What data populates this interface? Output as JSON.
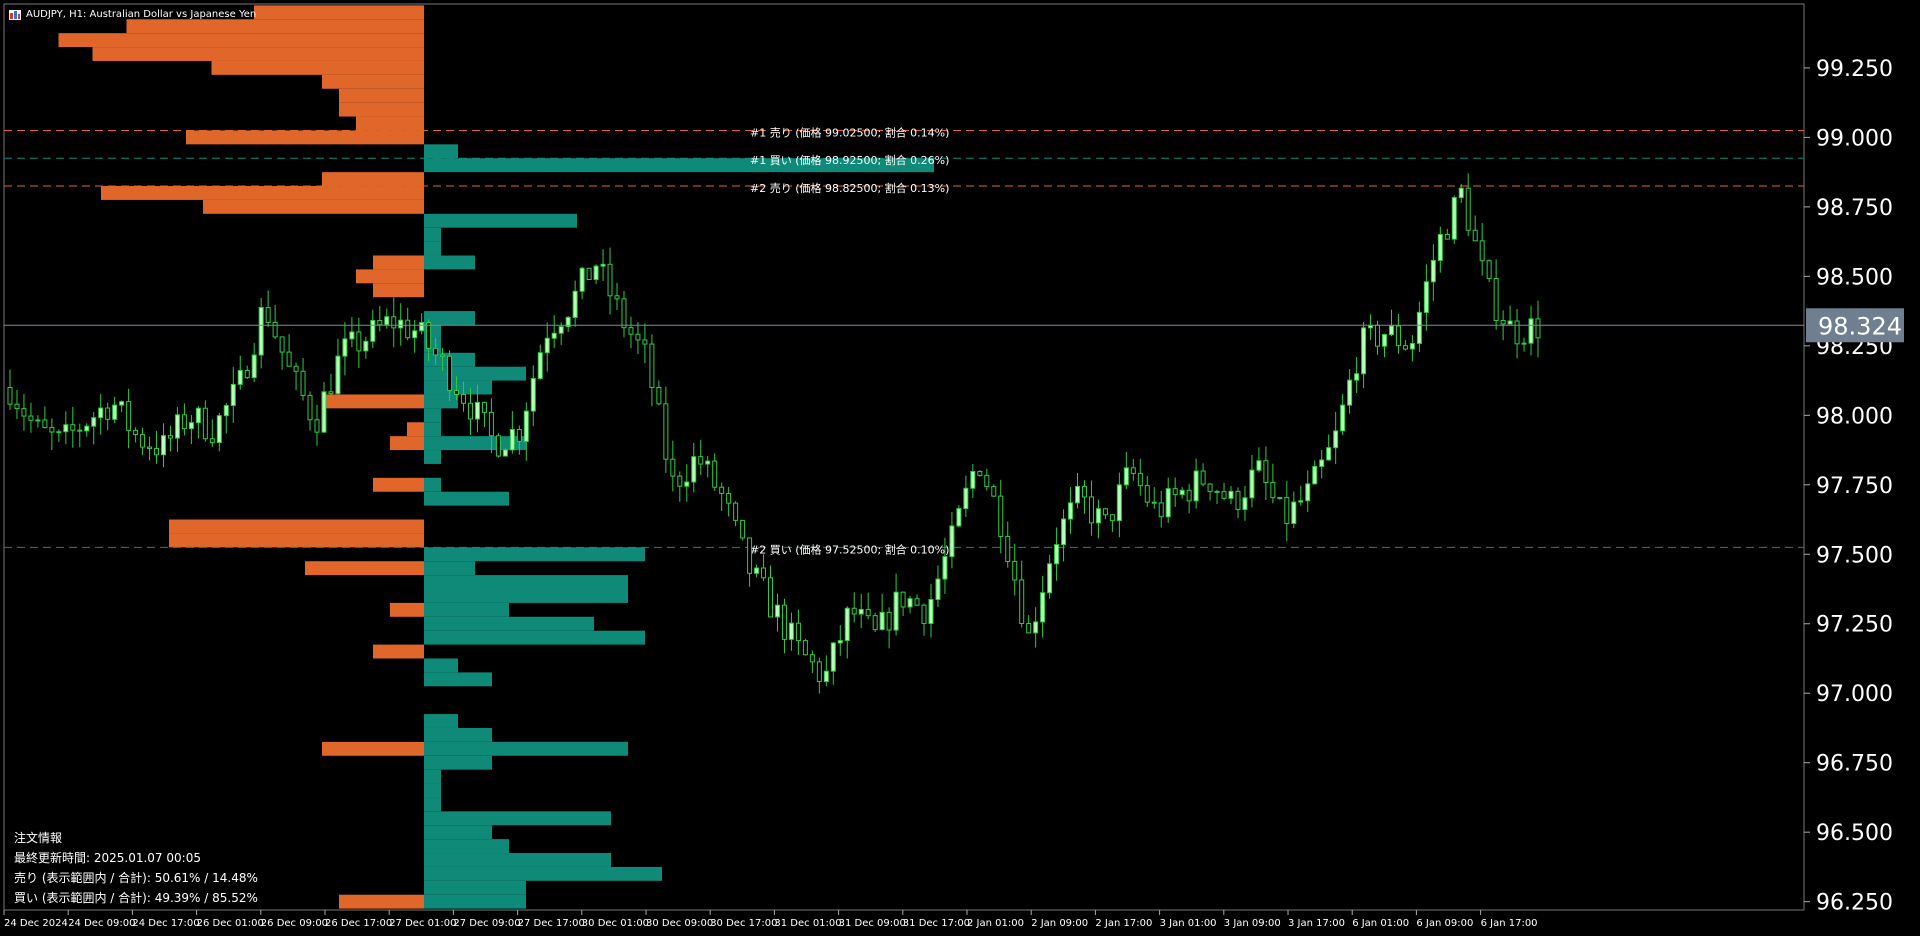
{
  "window": {
    "title": "AUDJPY, H1:  Australian Dollar vs Japanese Yen",
    "icon": "chart-window-icon"
  },
  "colors": {
    "background": "#000000",
    "grid": "#2a2a2a",
    "candle_up": "#b6ffb6",
    "candle_down": "#2ecc40",
    "sell_profile": "#e0662a",
    "buy_profile": "#0f8a78",
    "current_price_line": "#6f8fa8",
    "price_badge": "#6f7f8f"
  },
  "current_price": "98.324",
  "info_panel": {
    "title": "注文情報",
    "updated": "最終更新時間: 2025.01.07 00:05",
    "sell": "売り (表示範囲内 / 合計): 50.61% / 14.48%",
    "buy": "買い (表示範囲内 / 合計): 49.39% / 85.52%"
  },
  "chart_data": {
    "type": "candlestick",
    "symbol": "AUDJPY",
    "timeframe": "H1",
    "ylim": [
      96.22,
      99.48
    ],
    "y_ticks": [
      "99.250",
      "99.000",
      "98.750",
      "98.500",
      "98.250",
      "98.000",
      "97.750",
      "97.500",
      "97.250",
      "97.000",
      "96.750",
      "96.500",
      "96.250"
    ],
    "x_ticks": [
      "24 Dec 2024",
      "24 Dec 09:00",
      "24 Dec 17:00",
      "26 Dec 01:00",
      "26 Dec 09:00",
      "26 Dec 17:00",
      "27 Dec 01:00",
      "27 Dec 09:00",
      "27 Dec 17:00",
      "30 Dec 01:00",
      "30 Dec 09:00",
      "30 Dec 17:00",
      "31 Dec 01:00",
      "31 Dec 09:00",
      "31 Dec 17:00",
      "2 Jan 01:00",
      "2 Jan 09:00",
      "2 Jan 17:00",
      "3 Jan 01:00",
      "3 Jan 09:00",
      "3 Jan 17:00",
      "6 Jan 01:00",
      "6 Jan 09:00",
      "6 Jan 17:00"
    ],
    "close_path": [
      98.1,
      97.95,
      97.9,
      97.98,
      98.05,
      97.92,
      97.88,
      98.0,
      97.95,
      98.1,
      98.4,
      98.15,
      97.98,
      98.22,
      98.28,
      98.34,
      98.3,
      98.18,
      98.05,
      97.9,
      97.95,
      98.3,
      98.4,
      98.55,
      98.35,
      98.2,
      97.75,
      97.85,
      97.7,
      97.45,
      97.3,
      97.15,
      97.05,
      97.3,
      97.2,
      97.35,
      97.3,
      97.55,
      97.85,
      97.6,
      97.2,
      97.55,
      97.7,
      97.6,
      97.8,
      97.65,
      97.72,
      97.78,
      97.68,
      97.8,
      97.62,
      97.72,
      97.9,
      98.25,
      98.3,
      98.25,
      98.6,
      98.8,
      98.45,
      98.3,
      98.32
    ],
    "order_levels": [
      {
        "label": "#1 売り (価格 99.02500; 割合 0.14%)",
        "price": 99.025,
        "side": "sell"
      },
      {
        "label": "#1 買い (価格 98.92500; 割合 0.26%)",
        "price": 98.925,
        "side": "buy"
      },
      {
        "label": "#2 売り (価格 98.82500; 割合 0.13%)",
        "price": 98.825,
        "side": "sell"
      },
      {
        "label": "#2 買い (価格 97.52500; 割合 0.10%)",
        "price": 97.525,
        "side": "buy"
      }
    ],
    "sell_profile": [
      {
        "price": 99.45,
        "value": 1.0
      },
      {
        "price": 99.4,
        "value": 1.75
      },
      {
        "price": 99.35,
        "value": 2.15
      },
      {
        "price": 99.3,
        "value": 1.95
      },
      {
        "price": 99.25,
        "value": 1.25
      },
      {
        "price": 99.2,
        "value": 0.6
      },
      {
        "price": 99.15,
        "value": 0.5
      },
      {
        "price": 99.1,
        "value": 0.5
      },
      {
        "price": 99.05,
        "value": 0.4
      },
      {
        "price": 99.0,
        "value": 1.4
      },
      {
        "price": 98.85,
        "value": 0.6
      },
      {
        "price": 98.8,
        "value": 1.9
      },
      {
        "price": 98.75,
        "value": 1.3
      },
      {
        "price": 98.55,
        "value": 0.3
      },
      {
        "price": 98.5,
        "value": 0.4
      },
      {
        "price": 98.45,
        "value": 0.3
      },
      {
        "price": 98.05,
        "value": 0.6
      },
      {
        "price": 97.95,
        "value": 0.1
      },
      {
        "price": 97.9,
        "value": 0.2
      },
      {
        "price": 97.75,
        "value": 0.3
      },
      {
        "price": 97.6,
        "value": 1.5
      },
      {
        "price": 97.55,
        "value": 1.5
      },
      {
        "price": 97.45,
        "value": 0.7
      },
      {
        "price": 97.3,
        "value": 0.2
      },
      {
        "price": 97.15,
        "value": 0.3
      },
      {
        "price": 96.8,
        "value": 0.6
      },
      {
        "price": 96.25,
        "value": 0.5
      }
    ],
    "buy_profile": [
      {
        "price": 98.95,
        "value": 0.2
      },
      {
        "price": 98.9,
        "value": 3.0
      },
      {
        "price": 98.7,
        "value": 0.9
      },
      {
        "price": 98.65,
        "value": 0.1
      },
      {
        "price": 98.6,
        "value": 0.1
      },
      {
        "price": 98.55,
        "value": 0.3
      },
      {
        "price": 98.35,
        "value": 0.3
      },
      {
        "price": 98.3,
        "value": 0.1
      },
      {
        "price": 98.25,
        "value": 0.1
      },
      {
        "price": 98.2,
        "value": 0.3
      },
      {
        "price": 98.15,
        "value": 0.6
      },
      {
        "price": 98.1,
        "value": 0.4
      },
      {
        "price": 98.05,
        "value": 0.2
      },
      {
        "price": 98.0,
        "value": 0.1
      },
      {
        "price": 97.95,
        "value": 0.1
      },
      {
        "price": 97.9,
        "value": 0.6
      },
      {
        "price": 97.85,
        "value": 0.1
      },
      {
        "price": 97.75,
        "value": 0.1
      },
      {
        "price": 97.7,
        "value": 0.5
      },
      {
        "price": 97.5,
        "value": 1.3
      },
      {
        "price": 97.45,
        "value": 0.3
      },
      {
        "price": 97.4,
        "value": 1.2
      },
      {
        "price": 97.35,
        "value": 1.2
      },
      {
        "price": 97.3,
        "value": 0.5
      },
      {
        "price": 97.25,
        "value": 1.0
      },
      {
        "price": 97.2,
        "value": 1.3
      },
      {
        "price": 97.1,
        "value": 0.2
      },
      {
        "price": 97.05,
        "value": 0.4
      },
      {
        "price": 96.9,
        "value": 0.2
      },
      {
        "price": 96.85,
        "value": 0.4
      },
      {
        "price": 96.8,
        "value": 1.2
      },
      {
        "price": 96.75,
        "value": 0.4
      },
      {
        "price": 96.7,
        "value": 0.1
      },
      {
        "price": 96.65,
        "value": 0.1
      },
      {
        "price": 96.6,
        "value": 0.1
      },
      {
        "price": 96.55,
        "value": 1.1
      },
      {
        "price": 96.5,
        "value": 0.4
      },
      {
        "price": 96.45,
        "value": 0.5
      },
      {
        "price": 96.4,
        "value": 1.1
      },
      {
        "price": 96.35,
        "value": 1.4
      },
      {
        "price": 96.3,
        "value": 0.6
      },
      {
        "price": 96.25,
        "value": 0.6
      }
    ]
  }
}
